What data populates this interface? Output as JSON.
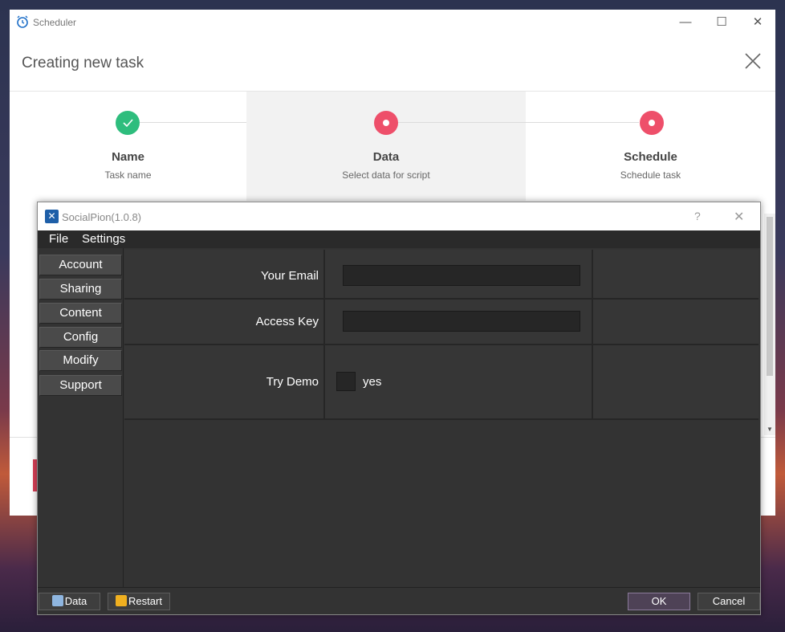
{
  "scheduler": {
    "app_title": "Scheduler",
    "header_title": "Creating new task",
    "steps": [
      {
        "name": "Name",
        "desc": "Task name",
        "state": "done"
      },
      {
        "name": "Data",
        "desc": "Select data for script",
        "state": "active"
      },
      {
        "name": "Schedule",
        "desc": "Schedule task",
        "state": "pending"
      }
    ]
  },
  "dialog": {
    "title": "SocialPion(1.0.8)",
    "help": "?",
    "menu": {
      "file": "File",
      "settings": "Settings"
    },
    "sidebar": [
      "Account",
      "Sharing",
      "Content",
      "Config",
      "Modify",
      "Support"
    ],
    "form": {
      "email_label": "Your Email",
      "email_value": "",
      "access_key_label": "Access Key",
      "access_key_value": "",
      "try_demo_label": "Try Demo",
      "try_demo_option": "yes",
      "try_demo_checked": false
    },
    "buttons": {
      "data": "Data",
      "restart": "Restart",
      "ok": "OK",
      "cancel": "Cancel"
    }
  },
  "colors": {
    "done": "#2ebd7d",
    "pending": "#ee4f6a",
    "accent": "#1e5fa8"
  }
}
